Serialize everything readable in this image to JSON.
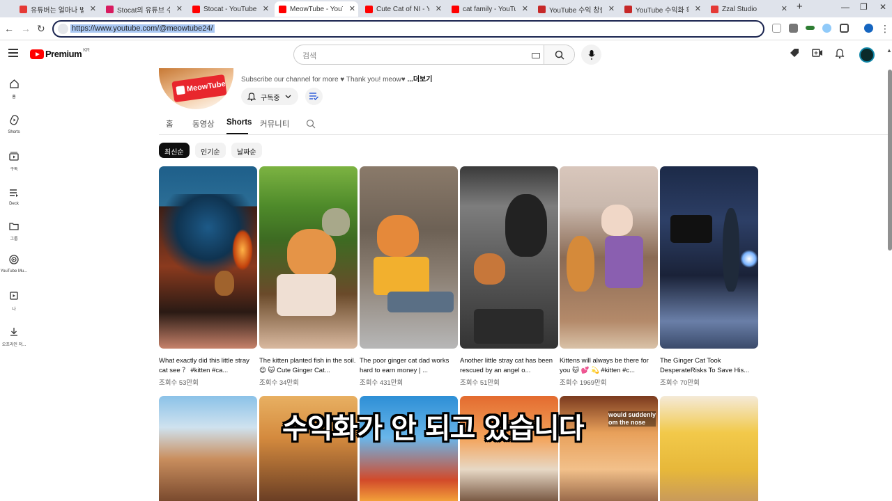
{
  "browser": {
    "tabs": [
      {
        "title": "유튜버는 얼마나 벌?",
        "favicon_color": "#e53935"
      },
      {
        "title": "Stocat의 유튜브 수익",
        "favicon_color": "#d81b60"
      },
      {
        "title": "Stocat - YouTube",
        "favicon_color": "#ff0000"
      },
      {
        "title": "MeowTube - YouTube",
        "favicon_color": "#ff0000"
      },
      {
        "title": "Cute Cat of NI - You",
        "favicon_color": "#ff0000"
      },
      {
        "title": "cat family - YouTube",
        "favicon_color": "#ff0000"
      },
      {
        "title": "YouTube 수익 창출",
        "favicon_color": "#c62828"
      },
      {
        "title": "YouTube 수익화 확인",
        "favicon_color": "#c62828"
      },
      {
        "title": "Zzal Studio",
        "favicon_color": "#e53935"
      }
    ],
    "new_tab": "+",
    "url": "https://www.youtube.com/@meowtube24/"
  },
  "youtube": {
    "logo_text": "Premium",
    "region": "KR",
    "search_placeholder": "검색"
  },
  "sidebar": [
    {
      "label": "홈",
      "icon": "home-icon"
    },
    {
      "label": "Shorts",
      "icon": "shorts-icon"
    },
    {
      "label": "구독",
      "icon": "subscriptions-icon"
    },
    {
      "label": "Deck",
      "icon": "deck-icon"
    },
    {
      "label": "그룹",
      "icon": "folder-icon"
    },
    {
      "label": "YouTube Mu...",
      "icon": "music-icon"
    },
    {
      "label": "나",
      "icon": "you-icon"
    },
    {
      "label": "오프라인 저...",
      "icon": "download-icon"
    }
  ],
  "channel": {
    "logo_text": "MeowTube",
    "description": "Subscribe our channel for more ♥ Thank you!  meow♥ ",
    "more": "...더보기",
    "subscribe_label": "구독중"
  },
  "tabs": [
    "홈",
    "동영상",
    "Shorts",
    "커뮤니티"
  ],
  "filters": [
    "최신순",
    "인기순",
    "날짜순"
  ],
  "shorts": [
    {
      "title": "What exactly did this little stray cat see ？ #kitten #ca...",
      "views": "조회수 53만회"
    },
    {
      "title": "The kitten planted fish in the soil. 😊 🐱 Cute Ginger Cat...",
      "views": "조회수 34만회"
    },
    {
      "title": "The poor ginger cat dad works hard to earn money | ...",
      "views": "조회수 431만회"
    },
    {
      "title": "Another little stray cat has been rescued by an angel o...",
      "views": "조회수 51만회"
    },
    {
      "title": "Kittens will always be there for you 🐱 💕 💫 #kitten #c...",
      "views": "조회수 1969만회"
    },
    {
      "title": "The Ginger Cat Took DesperateRisks To Save His...",
      "views": "조회수 70만회"
    }
  ],
  "thumb_text": [
    "would suddenly",
    "om the nose"
  ],
  "caption": "수익화가 안 되고 있습니다"
}
